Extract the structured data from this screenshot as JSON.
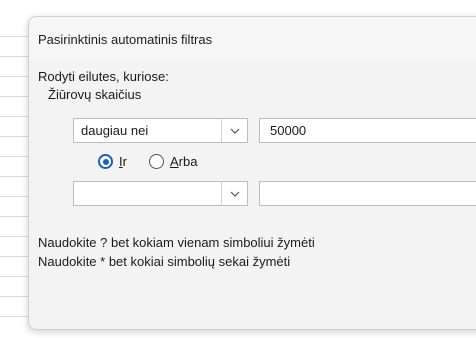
{
  "dialog": {
    "title": "Pasirinktinis automatinis filtras",
    "show_rows_label": "Rodyti eilutes, kuriose:",
    "field_name": "Žiūrovų skaičius",
    "condition1": {
      "operator": "daugiau nei",
      "value": "50000"
    },
    "logic": {
      "and_key": "I",
      "and_rest": "r",
      "or_key": "A",
      "or_rest": "rba",
      "selected": "and"
    },
    "condition2": {
      "operator": "",
      "value": ""
    },
    "hint1": "Naudokite ? bet kokiam vienam simboliui žymėti",
    "hint2": "Naudokite * bet kokiai simbolių sekai žymėti"
  },
  "colors": {
    "accent": "#1a5fb4",
    "dialog_bg": "#f3f3f3"
  }
}
